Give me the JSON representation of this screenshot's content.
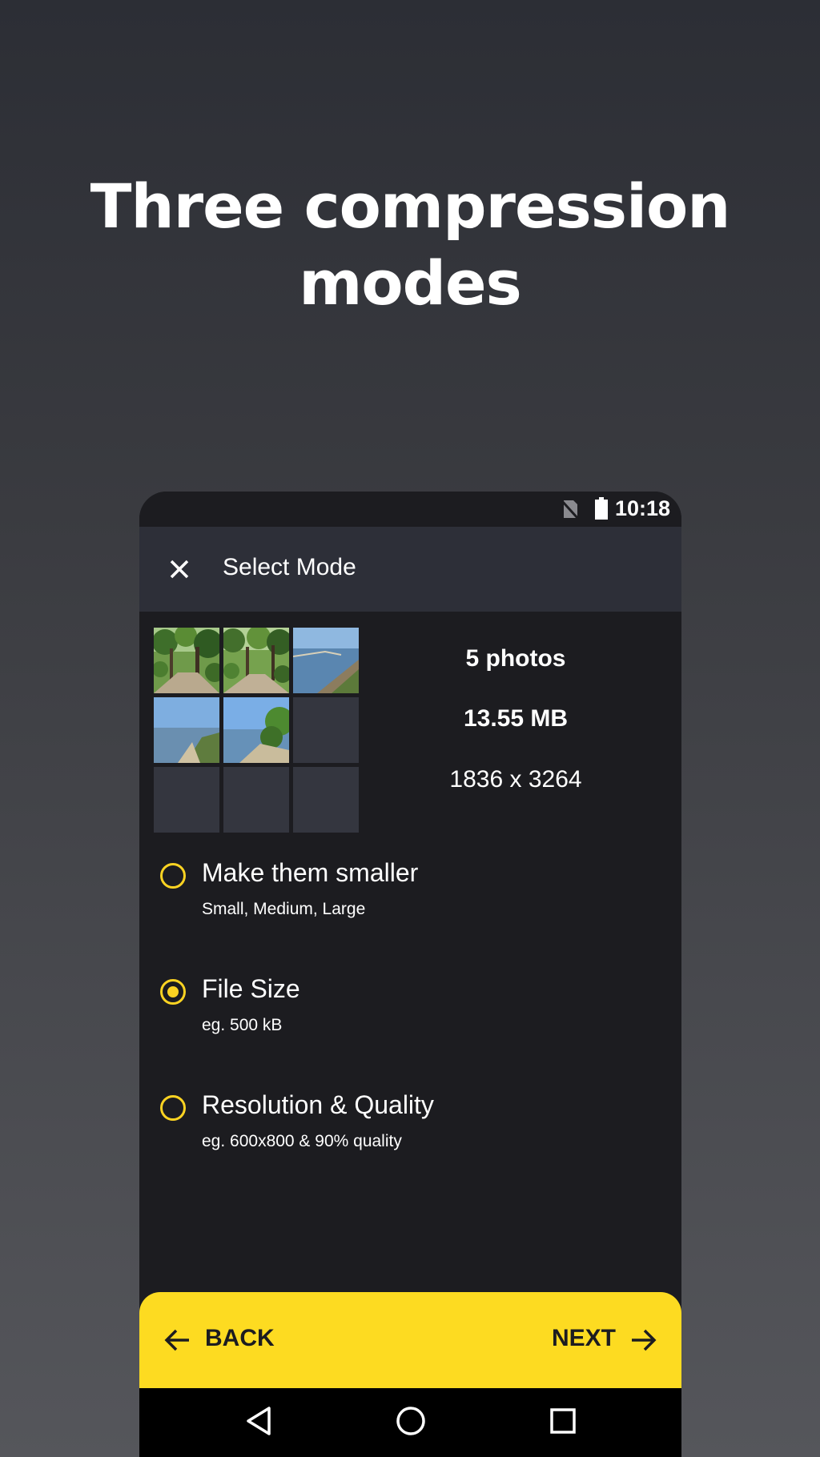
{
  "headline": {
    "line1": "Three compression",
    "line2": "modes"
  },
  "status_bar": {
    "time": "10:18",
    "icons": [
      "no-sim-icon",
      "battery-icon"
    ]
  },
  "app_bar": {
    "title": "Select Mode",
    "close_icon": "close-icon"
  },
  "summary": {
    "photo_count": "5 photos",
    "total_size": "13.55 MB",
    "resolution": "1836 x 3264",
    "thumbnails": [
      "forest-path",
      "forest-path",
      "lake-shore",
      "lake-shore",
      "lake-shore",
      "empty",
      "empty",
      "empty",
      "empty"
    ]
  },
  "options": [
    {
      "title": "Make them smaller",
      "subtitle": "Small, Medium, Large",
      "selected": false
    },
    {
      "title": "File Size",
      "subtitle": "eg. 500 kB",
      "selected": true
    },
    {
      "title": "Resolution & Quality",
      "subtitle": "eg. 600x800 & 90% quality",
      "selected": false
    }
  ],
  "bottom_bar": {
    "back_label": "BACK",
    "next_label": "NEXT"
  },
  "colors": {
    "accent": "#fddb21",
    "app_bar": "#2d2f38",
    "screen": "#1c1c20"
  },
  "nav_bar": {
    "icons": [
      "nav-back-icon",
      "nav-home-icon",
      "nav-recent-icon"
    ]
  }
}
